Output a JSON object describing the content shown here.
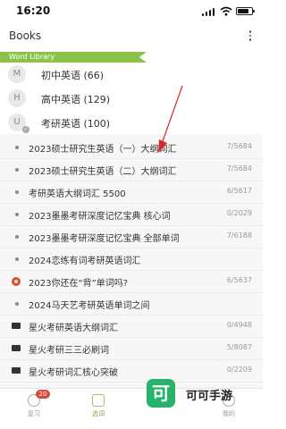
{
  "status_bar": {
    "time": "16:20",
    "battery_level": 0.8
  },
  "header": {
    "title": "Books",
    "more_icon": "vertical-dots-icon"
  },
  "word_library": {
    "label": "Word Library",
    "accent_color": "#8bc34a",
    "books": [
      {
        "letter": "M",
        "name": "初中英语 (66)"
      },
      {
        "letter": "H",
        "name": "高中英语 (129)"
      },
      {
        "letter": "U",
        "name": "考研英语 (100)",
        "tick": "✓"
      }
    ]
  },
  "word_lists": [
    {
      "title": "2023硕士研究生英语（一）大纲词汇",
      "count": "7/5684",
      "marker": "dot"
    },
    {
      "title": "2023硕士研究生英语（二）大纲词汇",
      "count": "7/5684",
      "marker": "dot"
    },
    {
      "title": "考研英语大纲词汇 5500",
      "count": "6/5617",
      "marker": "dot"
    },
    {
      "title": "2023墨墨考研深度记忆宝典 核心词",
      "count": "0/2029",
      "marker": "dot"
    },
    {
      "title": "2023墨墨考研深度记忆宝典 全部单词",
      "count": "7/6188",
      "marker": "dot"
    },
    {
      "title": "2024恋练有词考研英语词汇",
      "count": "",
      "marker": "dot"
    },
    {
      "title": "2023你还在“背”单词吗?",
      "count": "6/5637",
      "marker": "hot"
    },
    {
      "title": "2024马天艺考研英语单词之间",
      "count": "",
      "marker": "dot"
    },
    {
      "title": "星火考研英语大纲词汇",
      "count": "0/4948",
      "marker": "star"
    },
    {
      "title": "星火考研三三必刷词",
      "count": "5/8087",
      "marker": "star"
    },
    {
      "title": "星火考研词汇核心突破",
      "count": "0/2209",
      "marker": "star"
    }
  ],
  "tab_bar": {
    "tabs": [
      {
        "label": "复习",
        "badge": "20",
        "icon": "clock-icon"
      },
      {
        "label": "选词",
        "icon": "book-icon",
        "active": true
      },
      {
        "label": "",
        "icon": "chart-icon"
      },
      {
        "label": "我的",
        "icon": "user-icon"
      }
    ],
    "active_color": "#7aa83f",
    "badge_color": "#e0463a"
  },
  "watermark": {
    "logo_char": "可",
    "text": "可可手游",
    "color": "#27b36b"
  },
  "annotation": {
    "arrow_color": "#d62828"
  }
}
